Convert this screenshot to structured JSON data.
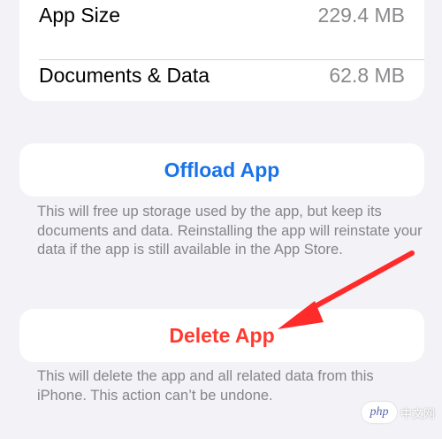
{
  "storage": {
    "app_size_label": "App Size",
    "app_size_value": "229.4 MB",
    "documents_label": "Documents & Data",
    "documents_value": "62.8 MB"
  },
  "offload": {
    "button_label": "Offload App",
    "note": "This will free up storage used by the app, but keep its documents and data. Reinstalling the app will reinstate your data if the app is still available in the App Store."
  },
  "delete": {
    "button_label": "Delete App",
    "note": "This will delete the app and all related data from this iPhone. This action can’t be undone."
  },
  "annotation": {
    "arrow_color": "#ff2a2a"
  },
  "watermark": {
    "logo": "php",
    "text": "中文网"
  },
  "colors": {
    "accent_blue": "#1a73e8",
    "destructive_red": "#ff3b30",
    "background": "#f2f2f7"
  }
}
